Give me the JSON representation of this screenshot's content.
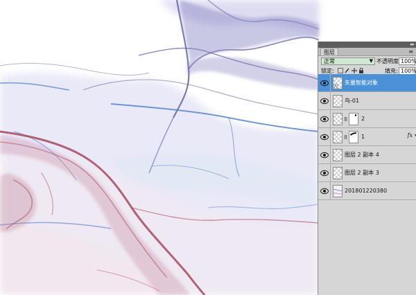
{
  "panel": {
    "tab_label": "图层",
    "blend_mode": "正常",
    "opacity_label": "不透明度:",
    "opacity_value": "100%",
    "lock_label": "锁定:",
    "fill_label": "填充:",
    "fill_value": "100%"
  },
  "layers": [
    {
      "name": "矢量智能对象",
      "selected": true
    },
    {
      "name": "鸟-01"
    },
    {
      "name": "2"
    },
    {
      "name": "1",
      "fx": "fx"
    },
    {
      "name": "图层 2 副本 4"
    },
    {
      "name": "图层 2 副本 3"
    },
    {
      "name": "201801220380"
    }
  ],
  "colors": {
    "selection": "#4a91d8",
    "panel_bg": "#d6d6d6",
    "ink_purple": "#5b5b9e",
    "ink_blue": "#4f7fc9",
    "ink_red": "#a8485e"
  }
}
